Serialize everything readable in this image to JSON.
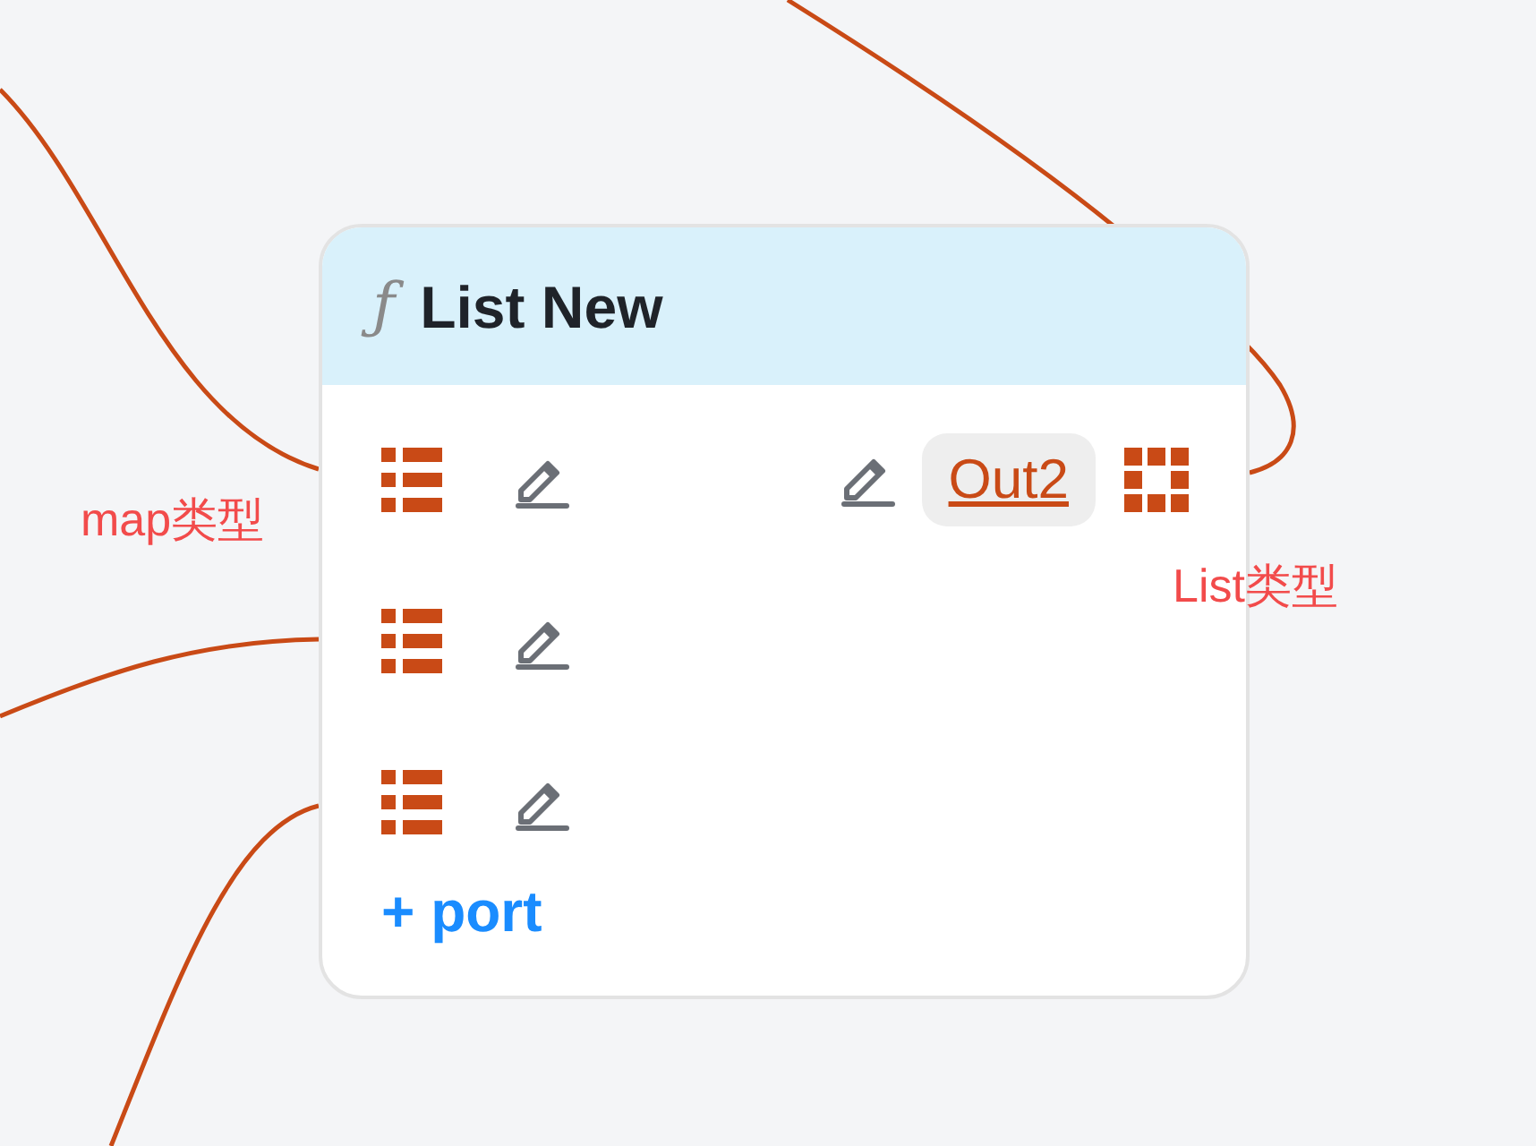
{
  "node": {
    "icon": "ƒ",
    "title": "List New",
    "rows": [
      {
        "input": {
          "kind": "map"
        },
        "output": {
          "label": "Out2",
          "kind": "list"
        }
      },
      {
        "input": {
          "kind": "map"
        }
      },
      {
        "input": {
          "kind": "map"
        }
      }
    ],
    "add_port": "+ port"
  },
  "annotations": [
    {
      "text": "map类型"
    },
    {
      "text": "List类型"
    }
  ]
}
